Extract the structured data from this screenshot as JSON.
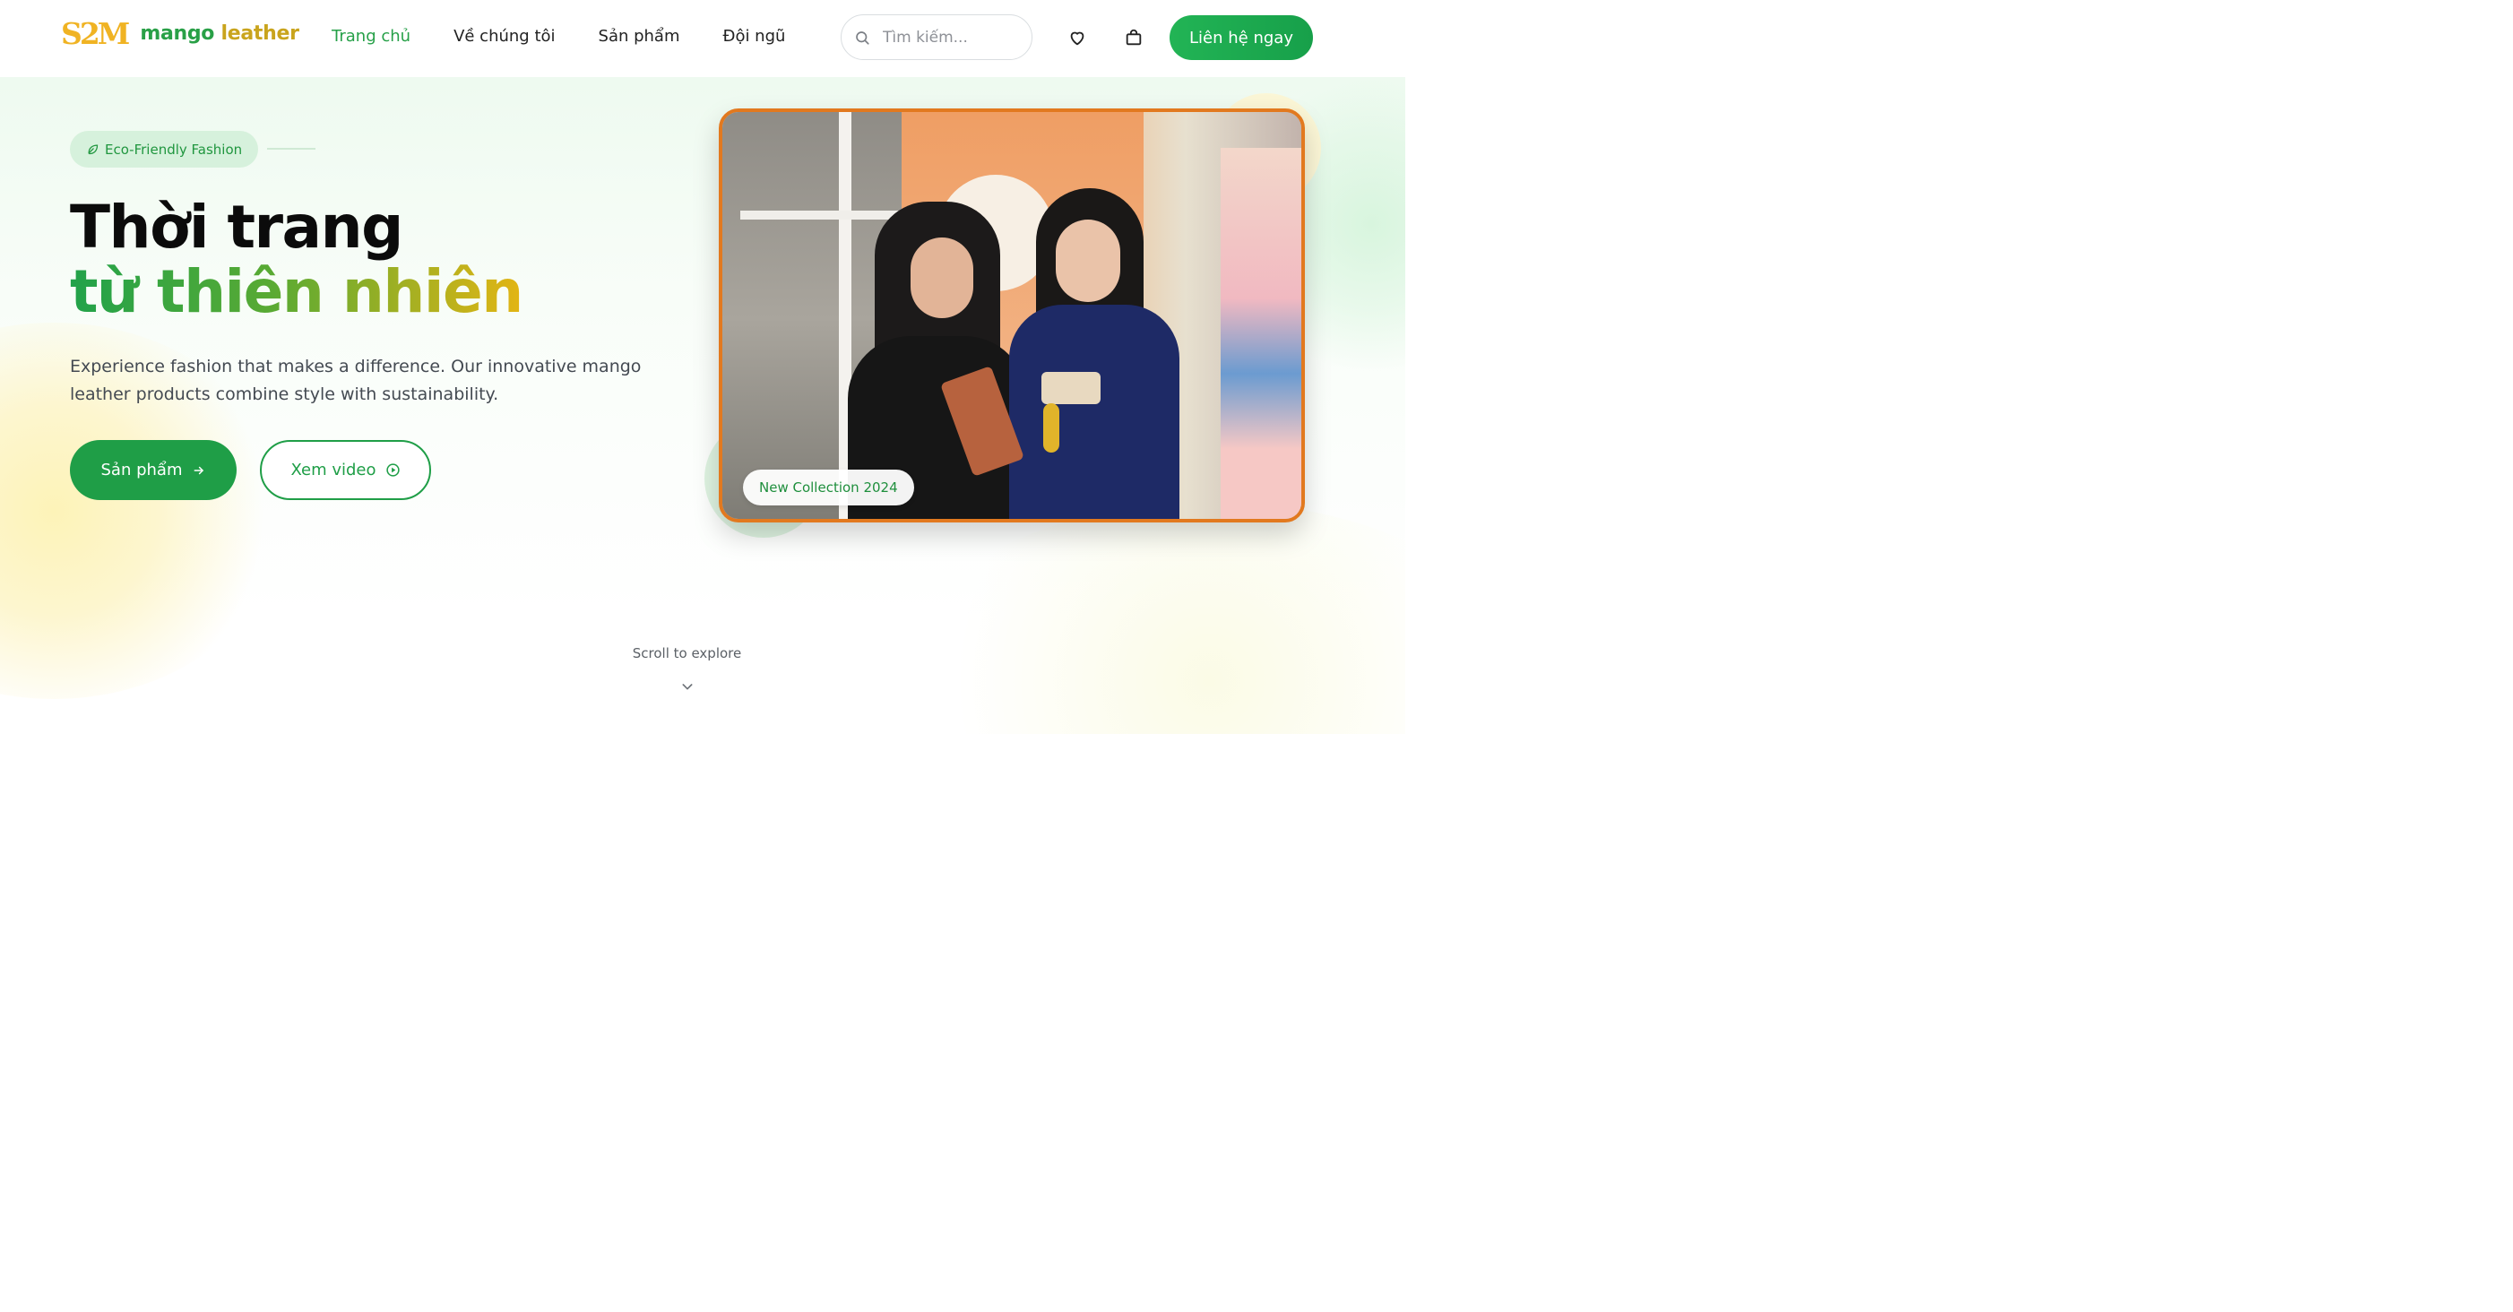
{
  "brand": {
    "mark": "S2M",
    "name_part1": "mango",
    "name_part2": "leather",
    "colors": {
      "green": "#26a048",
      "gold": "#e3b514",
      "accent_orange": "#e2791f"
    }
  },
  "nav": {
    "items": [
      {
        "label": "Trang chủ",
        "active": true
      },
      {
        "label": "Về chúng tôi",
        "active": false
      },
      {
        "label": "Sản phẩm",
        "active": false
      },
      {
        "label": "Đội ngũ",
        "active": false
      }
    ]
  },
  "search": {
    "placeholder": "Tìm kiếm...",
    "value": "",
    "icon": "search-icon"
  },
  "header_icons": [
    "heart-icon",
    "shopping-bag-icon"
  ],
  "cta": {
    "label": "Liên hệ ngay"
  },
  "hero": {
    "badge": {
      "icon": "leaf-icon",
      "label": "Eco-Friendly Fashion"
    },
    "title_line1": "Thời trang",
    "title_line2": "từ thiên nhiên",
    "description": "Experience fashion that makes a difference. Our innovative mango leather products combine style with sustainability.",
    "primary_button": {
      "label": "Sản phẩm",
      "icon": "arrow-right-icon"
    },
    "secondary_button": {
      "label": "Xem video",
      "icon": "play-circle-icon"
    },
    "image_tag": "New Collection 2024"
  },
  "scroll_hint": {
    "label": "Scroll to explore",
    "icon": "chevron-down-icon"
  }
}
